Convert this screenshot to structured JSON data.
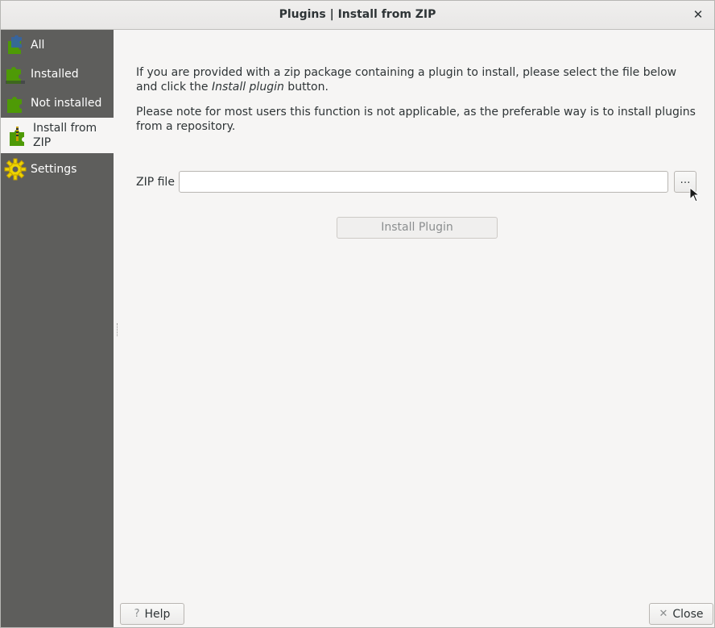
{
  "window": {
    "title": "Plugins | Install from ZIP"
  },
  "sidebar": {
    "items": [
      {
        "label": "All",
        "icon": "plugins-all-icon"
      },
      {
        "label": "Installed",
        "icon": "plugins-installed-icon"
      },
      {
        "label": "Not installed",
        "icon": "plugins-not-installed-icon"
      },
      {
        "label_line1": "Install from",
        "label_line2": "ZIP",
        "icon": "plugins-zip-icon",
        "active": true
      },
      {
        "label": "Settings",
        "icon": "settings-gear-icon"
      }
    ]
  },
  "main": {
    "intro_part1": "If you are provided with a zip package containing a plugin to install, please select the file below and click the ",
    "intro_emphasis": "Install plugin",
    "intro_part2": " button.",
    "note": "Please note for most users this function is not applicable, as the preferable way is to install plugins from a repository.",
    "zip_label": "ZIP file",
    "zip_value": "",
    "browse_label": "…",
    "install_label": "Install Plugin"
  },
  "footer": {
    "help_label": "Help",
    "close_label": "Close"
  },
  "colors": {
    "sidebar_bg": "#5e5e5c",
    "window_bg": "#f6f5f4",
    "puzzle_green": "#4e9a06",
    "disabled_text": "#8b8e8f"
  }
}
